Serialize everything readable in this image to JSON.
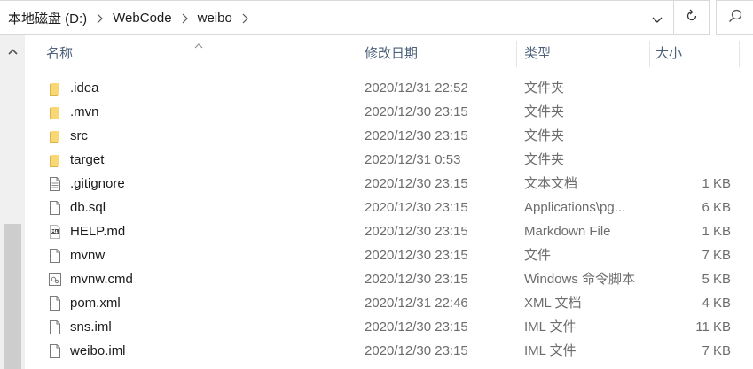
{
  "address_bar": {
    "crumbs": [
      "本地磁盘 (D:)",
      "WebCode",
      "weibo"
    ]
  },
  "columns": {
    "name": "名称",
    "date": "修改日期",
    "type": "类型",
    "size": "大小"
  },
  "files": [
    {
      "name": ".idea",
      "date": "2020/12/31 22:52",
      "type": "文件夹",
      "size": "",
      "icon": "folder-icon"
    },
    {
      "name": ".mvn",
      "date": "2020/12/30 23:15",
      "type": "文件夹",
      "size": "",
      "icon": "folder-icon"
    },
    {
      "name": "src",
      "date": "2020/12/30 23:15",
      "type": "文件夹",
      "size": "",
      "icon": "folder-icon"
    },
    {
      "name": "target",
      "date": "2020/12/31 0:53",
      "type": "文件夹",
      "size": "",
      "icon": "folder-icon"
    },
    {
      "name": ".gitignore",
      "date": "2020/12/30 23:15",
      "type": "文本文档",
      "size": "1 KB",
      "icon": "text-file-icon"
    },
    {
      "name": "db.sql",
      "date": "2020/12/30 23:15",
      "type": "Applications\\pg...",
      "size": "6 KB",
      "icon": "file-icon"
    },
    {
      "name": "HELP.md",
      "date": "2020/12/30 23:15",
      "type": "Markdown File",
      "size": "1 KB",
      "icon": "markdown-file-icon"
    },
    {
      "name": "mvnw",
      "date": "2020/12/30 23:15",
      "type": "文件",
      "size": "7 KB",
      "icon": "file-icon"
    },
    {
      "name": "mvnw.cmd",
      "date": "2020/12/30 23:15",
      "type": "Windows 命令脚本",
      "size": "5 KB",
      "icon": "script-file-icon"
    },
    {
      "name": "pom.xml",
      "date": "2020/12/31 22:46",
      "type": "XML 文档",
      "size": "4 KB",
      "icon": "file-icon"
    },
    {
      "name": "sns.iml",
      "date": "2020/12/30 23:15",
      "type": "IML 文件",
      "size": "11 KB",
      "icon": "file-icon"
    },
    {
      "name": "weibo.iml",
      "date": "2020/12/30 23:15",
      "type": "IML 文件",
      "size": "7 KB",
      "icon": "file-icon"
    }
  ]
}
